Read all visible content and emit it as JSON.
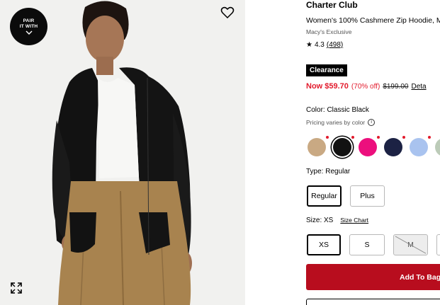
{
  "image": {
    "pair_badge_line1": "PAIR",
    "pair_badge_line2": "IT WITH",
    "icons": [
      "heart-icon",
      "expand-icon",
      "chevron-down-icon"
    ]
  },
  "product": {
    "brand": "Charter Club",
    "title": "Women's 100% Cashmere Zip Hoodie, M",
    "exclusive": "Macy's Exclusive",
    "rating": "4.3",
    "review_count": "(498)",
    "badge": "Clearance",
    "price_now": "Now $59.70",
    "price_pct": "(70% off)",
    "price_original": "$199.00",
    "price_details_link": "Deta"
  },
  "color": {
    "label": "Color: Classic Black",
    "pricing_note": "Pricing varies by color",
    "swatches": [
      {
        "name": "tan",
        "color": "#c9a983"
      },
      {
        "name": "classic-black",
        "color": "#121212",
        "selected": true
      },
      {
        "name": "pink",
        "color": "#ec0f7d"
      },
      {
        "name": "navy",
        "color": "#1c2244"
      },
      {
        "name": "light-blue",
        "color": "#a9c3ef"
      },
      {
        "name": "sage",
        "color": "#bccbb8"
      }
    ]
  },
  "type": {
    "label": "Type: Regular",
    "options": [
      "Regular",
      "Plus"
    ],
    "selected": "Regular"
  },
  "size": {
    "label": "Size: XS",
    "chart_link": "Size Chart",
    "options": [
      "XS",
      "S",
      "M"
    ],
    "selected": "XS",
    "unavailable": [
      "M"
    ]
  },
  "actions": {
    "add_to_bag": "Add To Bag"
  }
}
